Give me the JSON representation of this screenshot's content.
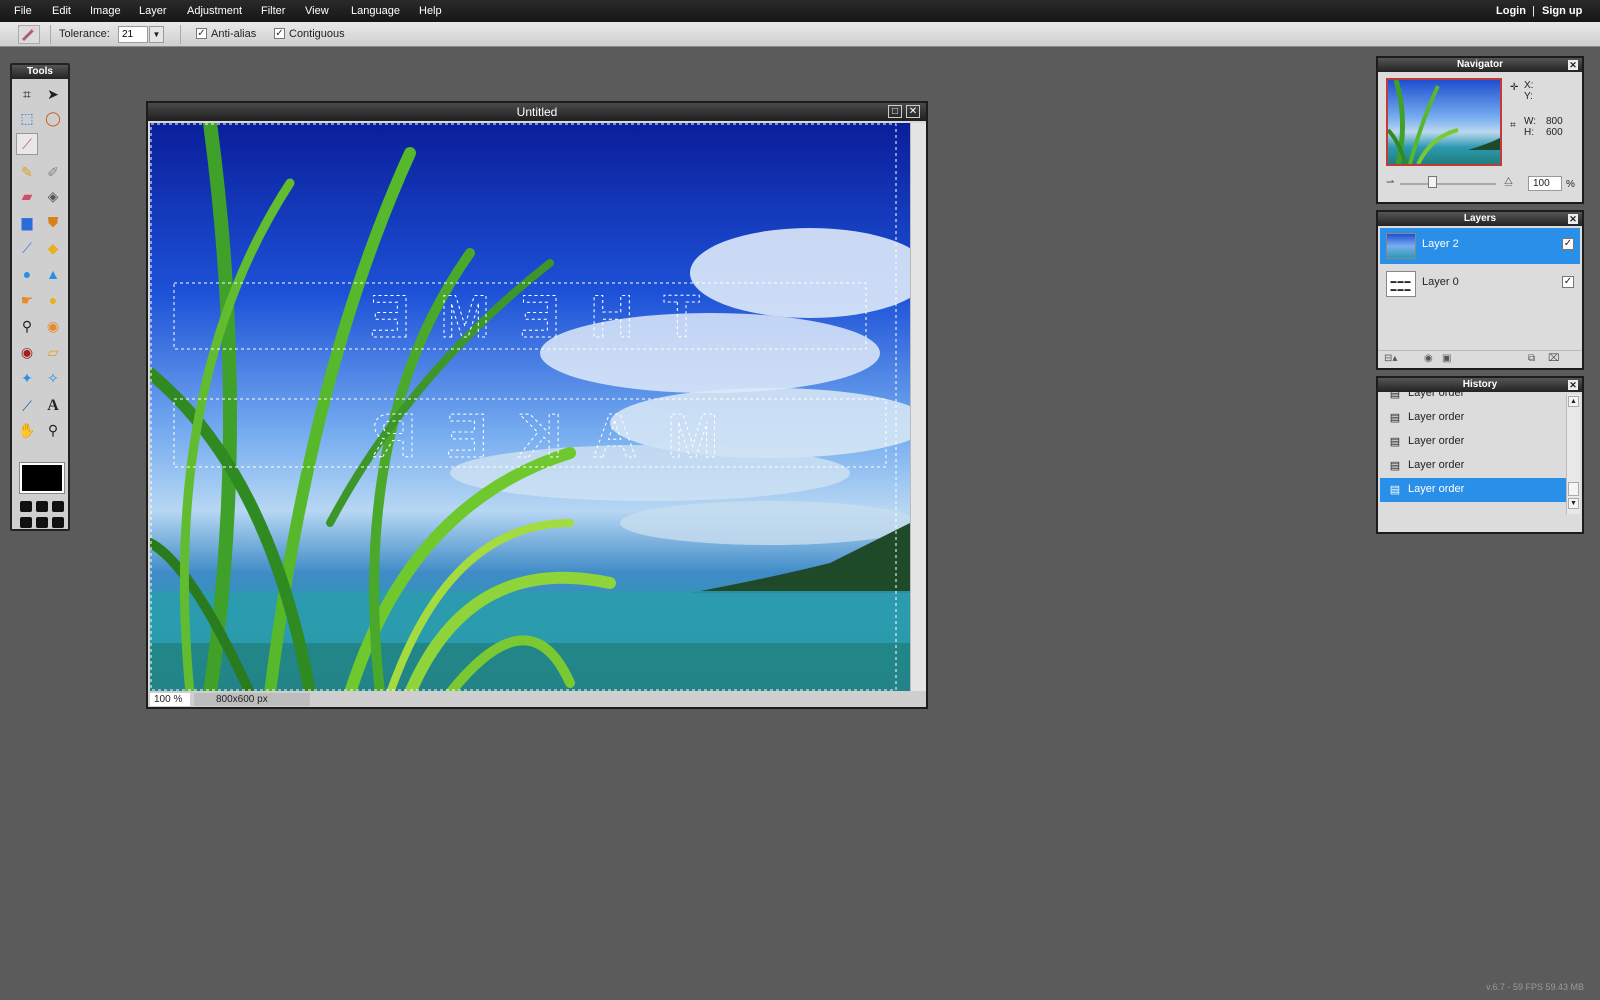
{
  "menubar": {
    "items": [
      "File",
      "Edit",
      "Image",
      "Layer",
      "Adjustment",
      "Filter",
      "View",
      "Language",
      "Help"
    ],
    "login": "Login",
    "separator": "|",
    "signup": "Sign up"
  },
  "options": {
    "tolerance_label": "Tolerance:",
    "tolerance_value": "21",
    "antialias_label": "Anti-alias",
    "antialias_checked": true,
    "contiguous_label": "Contiguous",
    "contiguous_checked": true
  },
  "tools": {
    "title": "Tools",
    "items": [
      "crop-icon",
      "move-icon",
      "marquee-icon",
      "lasso-icon",
      "magic-wand-icon",
      "pencil-icon",
      "brush-icon",
      "eraser-icon",
      "bucket-icon",
      "gradient-icon",
      "stamp-icon",
      "color-replace-icon",
      "drawing-icon",
      "blur-icon",
      "sharpen-icon",
      "smudge-icon",
      "sponge-icon",
      "dodge-icon",
      "burn-icon",
      "red-eye-icon",
      "spot-heal-icon",
      "bloat-icon",
      "pinch-icon",
      "color-picker-icon",
      "type-icon",
      "hand-icon",
      "zoom-icon"
    ],
    "foreground_color": "#000000"
  },
  "document": {
    "title": "Untitled",
    "zoom": "100 %",
    "size": "800x600 px",
    "selection_text": [
      "THEME",
      "MAKER"
    ]
  },
  "navigator": {
    "title": "Navigator",
    "x_label": "X:",
    "y_label": "Y:",
    "w_label": "W:",
    "w_value": "800",
    "h_label": "H:",
    "h_value": "600",
    "zoom_value": "100",
    "zoom_unit": "%"
  },
  "layers": {
    "title": "Layers",
    "items": [
      {
        "name": "Layer 2",
        "selected": true,
        "visible": true
      },
      {
        "name": "Layer 0",
        "selected": false,
        "visible": true
      }
    ]
  },
  "history": {
    "title": "History",
    "items": [
      "Layer order",
      "Layer order",
      "Layer order",
      "Layer order",
      "Layer order"
    ],
    "selected_index": 4
  },
  "footer": {
    "version": "v.6.7 - 59 FPS 59.43 MB"
  },
  "colors": {
    "selection_blue": "#2a8fe8",
    "panel_gray": "#dcdcdc",
    "background": "#5b5b5b"
  }
}
